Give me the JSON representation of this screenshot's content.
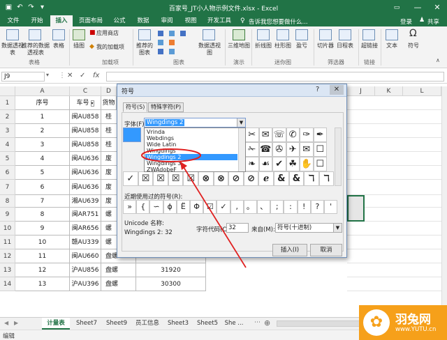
{
  "window": {
    "title": "百家号_JT小人物示例文件.xlsx - Excel",
    "controls": [
      "—",
      "❐",
      "✕"
    ]
  },
  "ribbon_tabs": [
    {
      "label": "文件"
    },
    {
      "label": "开始"
    },
    {
      "label": "插入",
      "active": true
    },
    {
      "label": "页面布局"
    },
    {
      "label": "公式"
    },
    {
      "label": "数据"
    },
    {
      "label": "审阅"
    },
    {
      "label": "视图"
    },
    {
      "label": "开发工具"
    }
  ],
  "tell_me": "告诉我您想要做什么...",
  "account": {
    "login": "登录",
    "share": "共享"
  },
  "ribbon": {
    "pivot_table": "数据透视表",
    "recommended_pivot": "推荐的数据透视表",
    "table": "表格",
    "illustrations": "插图",
    "store": "应用商店",
    "my_addins": "我的加载项",
    "recommended_charts": "推荐的图表",
    "pivot_chart": "数据透视图",
    "map3d": "三维地图",
    "line": "折线图",
    "column": "柱形图",
    "winloss": "盈亏",
    "slicer": "切片器",
    "timeline": "日程表",
    "hyperlink": "超链接",
    "text": "文本",
    "symbol": "符号",
    "groups": {
      "tables": "表格",
      "addins": "加载项",
      "charts": "图表",
      "tours": "演示",
      "sparklines": "迷你图",
      "filters": "筛选器",
      "links": "链接"
    }
  },
  "formula_bar": {
    "name_box": "J9",
    "fx": "fx"
  },
  "columns": [
    "A",
    "C",
    "D",
    "E",
    "F",
    "G",
    "H",
    "I",
    "J",
    "K",
    "L"
  ],
  "table": {
    "headers": [
      "序号",
      "车号",
      "货物"
    ],
    "rows": [
      {
        "n": "1",
        "plate": "闽AU858",
        "cargo": "桂",
        "val": ""
      },
      {
        "n": "2",
        "plate": "闽AU858",
        "cargo": "桂",
        "val": ""
      },
      {
        "n": "3",
        "plate": "闽AU858",
        "cargo": "桂",
        "val": ""
      },
      {
        "n": "4",
        "plate": "闽AU636",
        "cargo": "废",
        "val": ""
      },
      {
        "n": "5",
        "plate": "闽AU636",
        "cargo": "废",
        "val": ""
      },
      {
        "n": "6",
        "plate": "闽AU636",
        "cargo": "废",
        "val": ""
      },
      {
        "n": "7",
        "plate": "湘AU639",
        "cargo": "废",
        "val": ""
      },
      {
        "n": "8",
        "plate": "闽AR751",
        "cargo": "螺",
        "val": ""
      },
      {
        "n": "9",
        "plate": "闽AR656",
        "cargo": "螺",
        "val": ""
      },
      {
        "n": "10",
        "plate": "赣AU339",
        "cargo": "螺",
        "val": ""
      },
      {
        "n": "11",
        "plate": "闽AU660",
        "cargo": "盘螺",
        "val": "52780"
      },
      {
        "n": "12",
        "plate": "沪AU856",
        "cargo": "盘螺",
        "val": "31920"
      },
      {
        "n": "13",
        "plate": "沪AU396",
        "cargo": "盘螺",
        "val": "30300"
      }
    ]
  },
  "row_numbers": [
    "1",
    "2",
    "3",
    "4",
    "5",
    "6",
    "7",
    "8",
    "9",
    "10",
    "11",
    "12",
    "13",
    "14"
  ],
  "dialog": {
    "title": "符号",
    "tab_symbols": "符号(S)",
    "tab_special": "特殊字符(P)",
    "font_label": "字体(F):",
    "font_value": "Wingdings 2",
    "font_list": [
      "Vrinda",
      "Webdings",
      "Wide Latin",
      "Wingdings",
      "Wingdings 2",
      "Wingdings 3",
      "ZWAdobeF"
    ],
    "symbols_row1": [
      "☐",
      "☐",
      "☐",
      "☐",
      "✎",
      "✐",
      "✂",
      "✉",
      "☏",
      "✆",
      "✑",
      "✒"
    ],
    "symbols_row2": [
      "☐",
      "☐",
      "☐",
      "☐",
      "☐",
      "✂",
      "✁",
      "☎",
      "✇",
      "✈",
      "✉",
      "☐"
    ],
    "symbols_row3": [
      "✍",
      "☛",
      "☞",
      "☚",
      "☜",
      "❦",
      "❧",
      "☙",
      "✔",
      "☘",
      "✋",
      "☐"
    ],
    "symbols_row4": [
      "✓",
      "☒",
      "☒",
      "☒",
      "☒",
      "⊗",
      "⊗",
      "⊘",
      "⊘",
      "ℯ",
      "&",
      "&",
      "ℸ",
      "ℸ"
    ],
    "recent_label": "近期使用过的符号(R):",
    "recent": [
      "»",
      "{",
      "∽",
      "ϕ",
      "Ë",
      "Φ",
      "☑",
      "✓",
      ",",
      "。",
      "、",
      ";",
      ":",
      "!",
      "?",
      "'"
    ],
    "unicode_name_label": "Unicode 名称:",
    "unicode_name_value": "Wingdings 2: 32",
    "char_code_label": "字符代码(C):",
    "char_code_value": "32",
    "from_label": "来自(M):",
    "from_value": "符号(十进制)",
    "insert": "插入(I)",
    "cancel": "取消"
  },
  "sheets": [
    "计量表",
    "Sheet7",
    "Sheet9",
    "员工信息",
    "Sheet3",
    "Sheet5",
    "She ..."
  ],
  "status": {
    "mode": "编辑"
  },
  "watermark": {
    "brand": "羽兔网",
    "url": "www.YUTU.cn"
  },
  "colors": {
    "accent": "#217346",
    "selection": "#3399ff",
    "annotation": "#e02020"
  }
}
